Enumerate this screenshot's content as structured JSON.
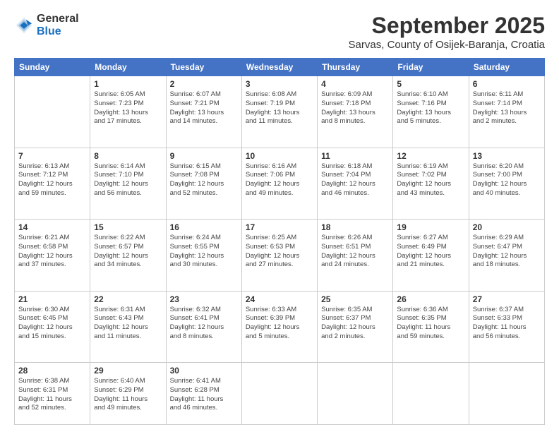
{
  "header": {
    "logo_general": "General",
    "logo_blue": "Blue",
    "month_title": "September 2025",
    "location": "Sarvas, County of Osijek-Baranja, Croatia"
  },
  "weekdays": [
    "Sunday",
    "Monday",
    "Tuesday",
    "Wednesday",
    "Thursday",
    "Friday",
    "Saturday"
  ],
  "weeks": [
    [
      {
        "day": "",
        "info": ""
      },
      {
        "day": "1",
        "info": "Sunrise: 6:05 AM\nSunset: 7:23 PM\nDaylight: 13 hours\nand 17 minutes."
      },
      {
        "day": "2",
        "info": "Sunrise: 6:07 AM\nSunset: 7:21 PM\nDaylight: 13 hours\nand 14 minutes."
      },
      {
        "day": "3",
        "info": "Sunrise: 6:08 AM\nSunset: 7:19 PM\nDaylight: 13 hours\nand 11 minutes."
      },
      {
        "day": "4",
        "info": "Sunrise: 6:09 AM\nSunset: 7:18 PM\nDaylight: 13 hours\nand 8 minutes."
      },
      {
        "day": "5",
        "info": "Sunrise: 6:10 AM\nSunset: 7:16 PM\nDaylight: 13 hours\nand 5 minutes."
      },
      {
        "day": "6",
        "info": "Sunrise: 6:11 AM\nSunset: 7:14 PM\nDaylight: 13 hours\nand 2 minutes."
      }
    ],
    [
      {
        "day": "7",
        "info": "Sunrise: 6:13 AM\nSunset: 7:12 PM\nDaylight: 12 hours\nand 59 minutes."
      },
      {
        "day": "8",
        "info": "Sunrise: 6:14 AM\nSunset: 7:10 PM\nDaylight: 12 hours\nand 56 minutes."
      },
      {
        "day": "9",
        "info": "Sunrise: 6:15 AM\nSunset: 7:08 PM\nDaylight: 12 hours\nand 52 minutes."
      },
      {
        "day": "10",
        "info": "Sunrise: 6:16 AM\nSunset: 7:06 PM\nDaylight: 12 hours\nand 49 minutes."
      },
      {
        "day": "11",
        "info": "Sunrise: 6:18 AM\nSunset: 7:04 PM\nDaylight: 12 hours\nand 46 minutes."
      },
      {
        "day": "12",
        "info": "Sunrise: 6:19 AM\nSunset: 7:02 PM\nDaylight: 12 hours\nand 43 minutes."
      },
      {
        "day": "13",
        "info": "Sunrise: 6:20 AM\nSunset: 7:00 PM\nDaylight: 12 hours\nand 40 minutes."
      }
    ],
    [
      {
        "day": "14",
        "info": "Sunrise: 6:21 AM\nSunset: 6:58 PM\nDaylight: 12 hours\nand 37 minutes."
      },
      {
        "day": "15",
        "info": "Sunrise: 6:22 AM\nSunset: 6:57 PM\nDaylight: 12 hours\nand 34 minutes."
      },
      {
        "day": "16",
        "info": "Sunrise: 6:24 AM\nSunset: 6:55 PM\nDaylight: 12 hours\nand 30 minutes."
      },
      {
        "day": "17",
        "info": "Sunrise: 6:25 AM\nSunset: 6:53 PM\nDaylight: 12 hours\nand 27 minutes."
      },
      {
        "day": "18",
        "info": "Sunrise: 6:26 AM\nSunset: 6:51 PM\nDaylight: 12 hours\nand 24 minutes."
      },
      {
        "day": "19",
        "info": "Sunrise: 6:27 AM\nSunset: 6:49 PM\nDaylight: 12 hours\nand 21 minutes."
      },
      {
        "day": "20",
        "info": "Sunrise: 6:29 AM\nSunset: 6:47 PM\nDaylight: 12 hours\nand 18 minutes."
      }
    ],
    [
      {
        "day": "21",
        "info": "Sunrise: 6:30 AM\nSunset: 6:45 PM\nDaylight: 12 hours\nand 15 minutes."
      },
      {
        "day": "22",
        "info": "Sunrise: 6:31 AM\nSunset: 6:43 PM\nDaylight: 12 hours\nand 11 minutes."
      },
      {
        "day": "23",
        "info": "Sunrise: 6:32 AM\nSunset: 6:41 PM\nDaylight: 12 hours\nand 8 minutes."
      },
      {
        "day": "24",
        "info": "Sunrise: 6:33 AM\nSunset: 6:39 PM\nDaylight: 12 hours\nand 5 minutes."
      },
      {
        "day": "25",
        "info": "Sunrise: 6:35 AM\nSunset: 6:37 PM\nDaylight: 12 hours\nand 2 minutes."
      },
      {
        "day": "26",
        "info": "Sunrise: 6:36 AM\nSunset: 6:35 PM\nDaylight: 11 hours\nand 59 minutes."
      },
      {
        "day": "27",
        "info": "Sunrise: 6:37 AM\nSunset: 6:33 PM\nDaylight: 11 hours\nand 56 minutes."
      }
    ],
    [
      {
        "day": "28",
        "info": "Sunrise: 6:38 AM\nSunset: 6:31 PM\nDaylight: 11 hours\nand 52 minutes."
      },
      {
        "day": "29",
        "info": "Sunrise: 6:40 AM\nSunset: 6:29 PM\nDaylight: 11 hours\nand 49 minutes."
      },
      {
        "day": "30",
        "info": "Sunrise: 6:41 AM\nSunset: 6:28 PM\nDaylight: 11 hours\nand 46 minutes."
      },
      {
        "day": "",
        "info": ""
      },
      {
        "day": "",
        "info": ""
      },
      {
        "day": "",
        "info": ""
      },
      {
        "day": "",
        "info": ""
      }
    ]
  ]
}
